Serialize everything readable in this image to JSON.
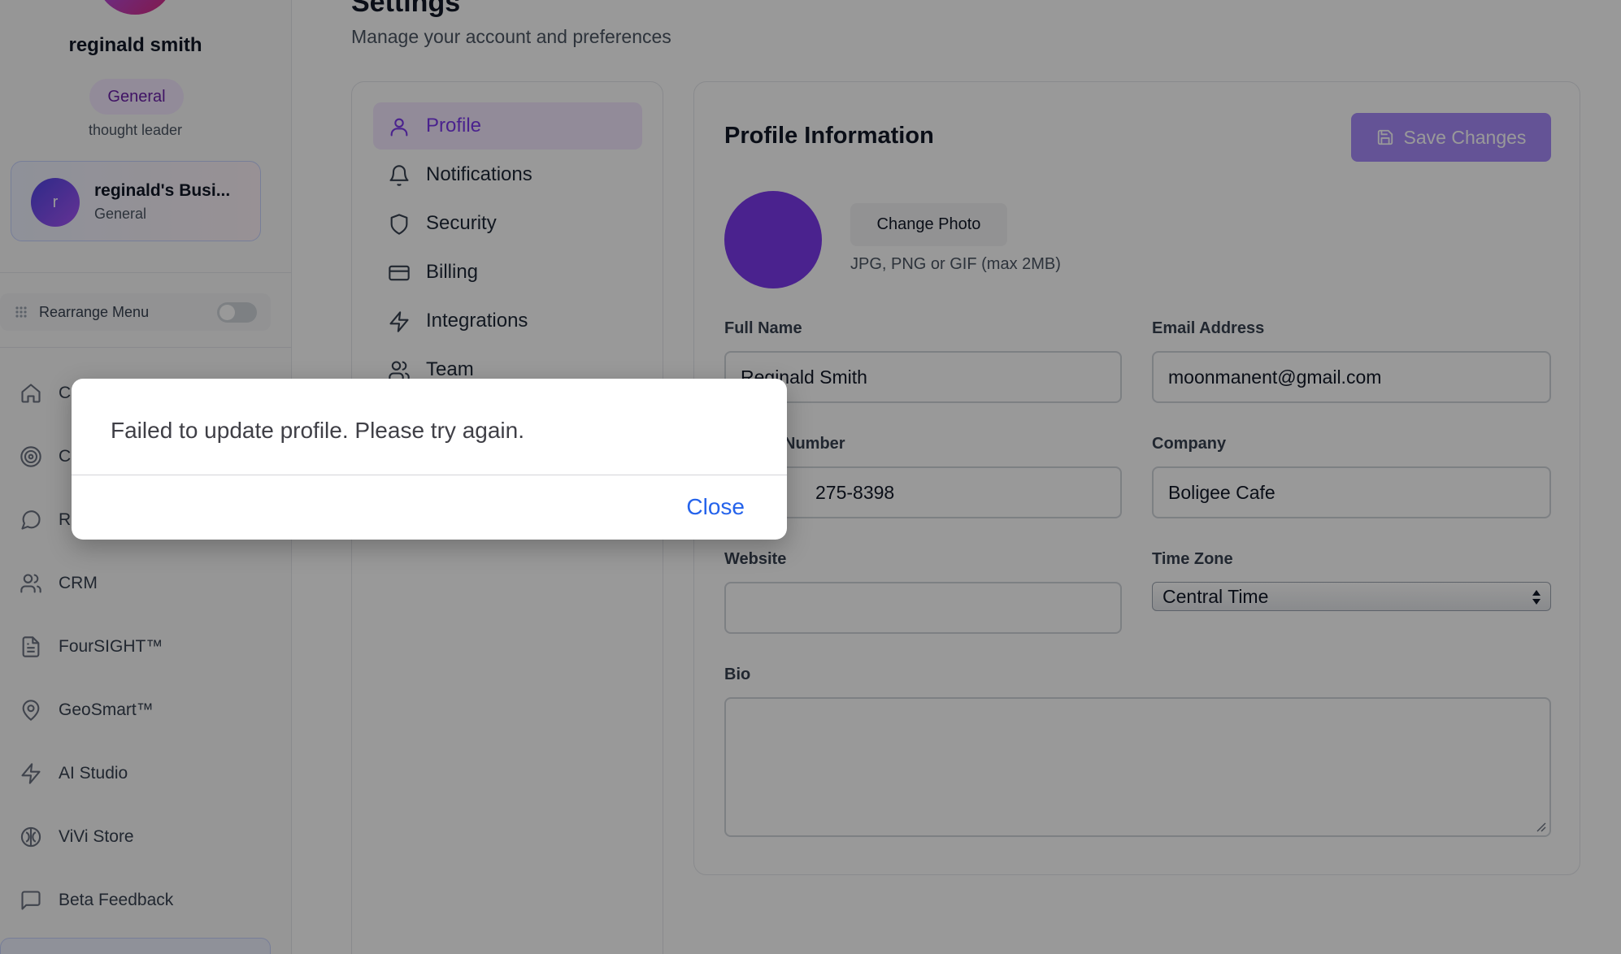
{
  "sidebar": {
    "user_name": "reginald smith",
    "role_badge": "General",
    "role_subtitle": "thought leader",
    "business": {
      "avatar_letter": "r",
      "name": "reginald's Busi...",
      "type": "General"
    },
    "rearrange_label": "Rearrange Menu",
    "nav": [
      {
        "label": "C",
        "icon": "home-icon"
      },
      {
        "label": "C",
        "icon": "target-icon"
      },
      {
        "label": "R",
        "icon": "message-circle-icon"
      },
      {
        "label": "CRM",
        "icon": "users-icon"
      },
      {
        "label": "FourSIGHT™",
        "icon": "file-text-icon"
      },
      {
        "label": "GeoSmart™",
        "icon": "map-pin-icon"
      },
      {
        "label": "AI Studio",
        "icon": "zap-icon"
      },
      {
        "label": "ViVi Store",
        "icon": "brain-icon"
      },
      {
        "label": "Beta Feedback",
        "icon": "message-square-icon"
      }
    ]
  },
  "header": {
    "title": "Settings",
    "subtitle": "Manage your account and preferences"
  },
  "settings_nav": [
    {
      "label": "Profile",
      "icon": "user-icon",
      "active": true
    },
    {
      "label": "Notifications",
      "icon": "bell-icon"
    },
    {
      "label": "Security",
      "icon": "shield-icon"
    },
    {
      "label": "Billing",
      "icon": "credit-card-icon"
    },
    {
      "label": "Integrations",
      "icon": "zap-icon"
    },
    {
      "label": "Team",
      "icon": "users-icon"
    }
  ],
  "profile": {
    "title": "Profile Information",
    "save_label": "Save Changes",
    "change_photo_label": "Change Photo",
    "photo_hint": "JPG, PNG or GIF (max 2MB)",
    "full_name_label": "Full Name",
    "full_name_value": "Reginald Smith",
    "email_label": "Email Address",
    "email_value": "moonmanent@gmail.com",
    "phone_label": "Number",
    "phone_value": "275-8398",
    "company_label": "Company",
    "company_value": "Boligee Cafe",
    "website_label": "Website",
    "website_value": "",
    "timezone_label": "Time Zone",
    "timezone_value": "Central Time",
    "bio_label": "Bio",
    "bio_value": ""
  },
  "dialog": {
    "message": "Failed to update profile. Please try again.",
    "close_label": "Close"
  },
  "colors": {
    "accent": "#7c3aed",
    "save_button": "#a78bfa",
    "link": "#2563eb"
  }
}
